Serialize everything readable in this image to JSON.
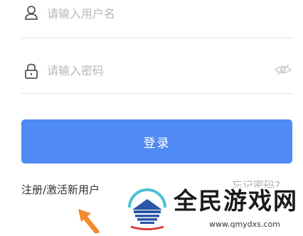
{
  "login_form": {
    "username_placeholder": "请输入用户名",
    "password_placeholder": "请输入密码",
    "login_label": "登录",
    "register_label": "注册/激活新用户",
    "forgot_label": "忘记密码?"
  },
  "icons": {
    "username": "user-icon",
    "password": "lock-icon",
    "visibility": "eye-slash-icon",
    "pointer": "arrow-up-left-icon"
  },
  "watermark": {
    "name": "全民游戏网",
    "url": "www.qmydxs.com"
  },
  "colors": {
    "primary": "#4f8af5",
    "arrow": "#f28a2e",
    "logo_blue": "#2c56a6"
  }
}
